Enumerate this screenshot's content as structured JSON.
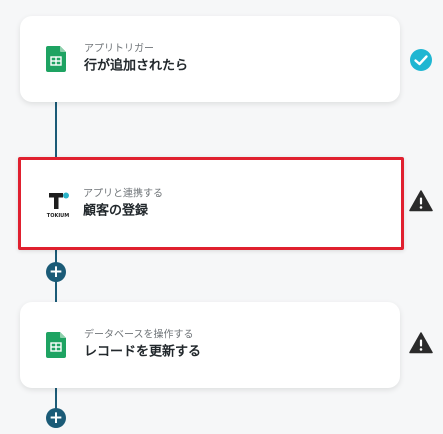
{
  "flow": {
    "steps": [
      {
        "subtitle": "アプリトリガー",
        "title": "行が追加されたら",
        "icon": "google-sheets-icon",
        "status": "complete",
        "status_icon": "check-circle-icon",
        "status_color": "#1fb6d2"
      },
      {
        "subtitle": "アプリと連携する",
        "title": "顧客の登録",
        "icon": "tokium-logo-icon",
        "logo_text": "TOKIUM",
        "status": "warning",
        "status_icon": "warning-icon",
        "status_color": "#2b2b2b",
        "selected": true,
        "highlight_color": "#e0202f"
      },
      {
        "subtitle": "データベースを操作する",
        "title": "レコードを更新する",
        "icon": "google-sheets-icon",
        "status": "warning",
        "status_icon": "warning-icon",
        "status_color": "#2b2b2b"
      }
    ],
    "add_button_label": "+"
  },
  "colors": {
    "connector": "#1b5b77",
    "sheets_green": "#1ea362",
    "background": "#f6f7f8"
  }
}
